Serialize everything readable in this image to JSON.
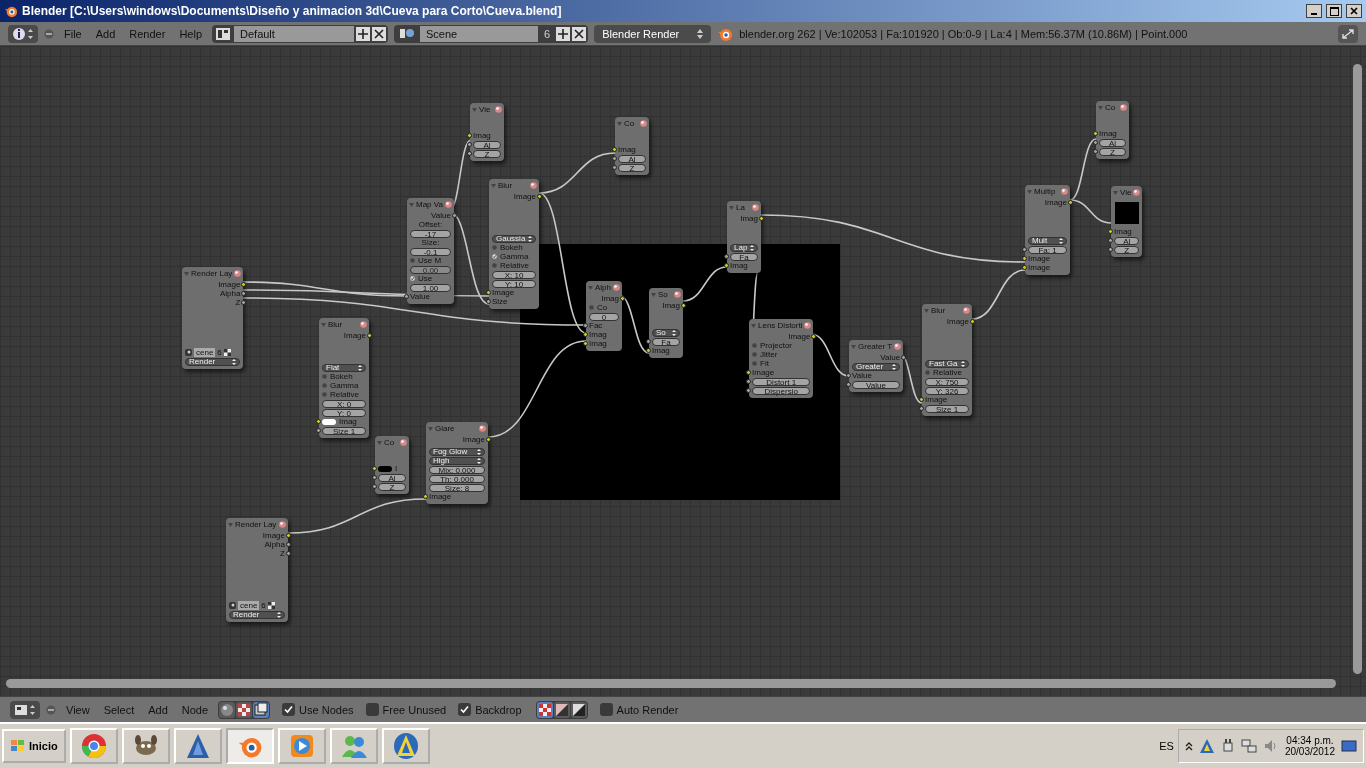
{
  "window": {
    "title": "Blender [C:\\Users\\windows\\Documents\\Diseño y animacion 3d\\Cueva para Corto\\Cueva.blend]"
  },
  "info_header": {
    "menus": [
      "File",
      "Add",
      "Render",
      "Help"
    ],
    "layout": "Default",
    "scene": "Scene",
    "scene_users": "6",
    "engine": "Blender Render",
    "stats": "blender.org 262 | Ve:102053 | Fa:101920 | Ob:0-9 | La:4 | Mem:56.37M (10.86M) | Point.000"
  },
  "node_editor": {
    "nodes": [
      {
        "title": "Vie",
        "rows": [
          {
            "kind": "in",
            "label": "Imag",
            "image_socket": true
          },
          {
            "kind": "field",
            "label": "Al",
            "image_socket": false
          },
          {
            "kind": "field",
            "label": "Z",
            "image_socket": false
          }
        ]
      },
      {
        "title": "Co",
        "rows": [
          {
            "kind": "in",
            "label": "Imag",
            "image_socket": true
          },
          {
            "kind": "field",
            "label": "Al",
            "image_socket": false
          },
          {
            "kind": "field",
            "label": "Z",
            "image_socket": false
          }
        ]
      },
      {
        "title": "Blur",
        "rows": [
          {
            "kind": "out",
            "label": "Image",
            "image_socket": true
          },
          {
            "kind": "menu",
            "label": "Gaussia"
          },
          {
            "kind": "option",
            "label": "Bokeh",
            "checked": false
          },
          {
            "kind": "option",
            "label": "Gamma",
            "checked": true
          },
          {
            "kind": "option",
            "label": "Relative",
            "checked": false
          },
          {
            "kind": "field",
            "label": "X: 10"
          },
          {
            "kind": "field",
            "label": "Y: 10"
          },
          {
            "kind": "in",
            "label": "Image",
            "image_socket": true
          },
          {
            "kind": "in",
            "label": "Size",
            "image_socket": false
          }
        ]
      },
      {
        "title": "Map Va",
        "rows": [
          {
            "kind": "out",
            "label": "Value",
            "image_socket": false
          },
          {
            "kind": "text",
            "label": "Offset:"
          },
          {
            "kind": "field",
            "label": "-17"
          },
          {
            "kind": "text",
            "label": "Size:"
          },
          {
            "kind": "field",
            "label": "-0.1"
          },
          {
            "kind": "option",
            "label": "Use M",
            "checked": false
          },
          {
            "kind": "field",
            "label": "0.00",
            "disabled": true
          },
          {
            "kind": "option",
            "label": "Use",
            "checked": true
          },
          {
            "kind": "field",
            "label": "1.00"
          },
          {
            "kind": "in",
            "label": "Value",
            "image_socket": false
          }
        ]
      },
      {
        "title": "Render Lay",
        "rows": [
          {
            "kind": "out",
            "label": "Image",
            "image_socket": true
          },
          {
            "kind": "out",
            "label": "Alpha",
            "image_socket": false
          },
          {
            "kind": "out",
            "label": "Z",
            "image_socket": false
          },
          {
            "kind": "scene",
            "label": "cene",
            "users": "6"
          },
          {
            "kind": "menu",
            "label": "Render"
          }
        ]
      },
      {
        "title": "Blur",
        "rows": [
          {
            "kind": "out",
            "label": "Image",
            "image_socket": true
          },
          {
            "kind": "menu",
            "label": "Flat"
          },
          {
            "kind": "option",
            "label": "Bokeh",
            "checked": false
          },
          {
            "kind": "option",
            "label": "Gamma",
            "checked": false
          },
          {
            "kind": "option",
            "label": "Relative",
            "checked": false
          },
          {
            "kind": "field",
            "label": "X: 0"
          },
          {
            "kind": "field",
            "label": "Y: 0"
          },
          {
            "kind": "swatch",
            "label": "Imag",
            "color": "#ffffff",
            "image_socket": true
          },
          {
            "kind": "field",
            "label": "Size 1",
            "image_socket": false
          }
        ]
      },
      {
        "title": "Alph",
        "rows": [
          {
            "kind": "out",
            "label": "Imag",
            "image_socket": true
          },
          {
            "kind": "option",
            "label": "Co",
            "checked": false
          },
          {
            "kind": "field",
            "label": "0"
          },
          {
            "kind": "in",
            "label": "Fac",
            "image_socket": false
          },
          {
            "kind": "in",
            "label": "Imag",
            "image_socket": true
          },
          {
            "kind": "in",
            "label": "Imag",
            "image_socket": true
          }
        ]
      },
      {
        "title": "So",
        "rows": [
          {
            "kind": "out",
            "label": "Imag",
            "image_socket": true
          },
          {
            "kind": "menu",
            "label": "So"
          },
          {
            "kind": "field",
            "label": "Fa",
            "image_socket": false
          },
          {
            "kind": "in",
            "label": "Imag",
            "image_socket": true
          }
        ]
      },
      {
        "title": "La",
        "rows": [
          {
            "kind": "out",
            "label": "Imag",
            "image_socket": true
          },
          {
            "kind": "menu",
            "label": "Lap"
          },
          {
            "kind": "field",
            "label": "Fa",
            "image_socket": false
          },
          {
            "kind": "in",
            "label": "Imag",
            "image_socket": true
          }
        ]
      },
      {
        "title": "Lens Distorti",
        "rows": [
          {
            "kind": "out",
            "label": "Image",
            "image_socket": true
          },
          {
            "kind": "option",
            "label": "Projector",
            "checked": false
          },
          {
            "kind": "option",
            "label": "Jitter",
            "checked": false
          },
          {
            "kind": "option",
            "label": "Fit",
            "checked": false
          },
          {
            "kind": "in",
            "label": "Image",
            "image_socket": true
          },
          {
            "kind": "field",
            "label": "Distort 1",
            "image_socket": false
          },
          {
            "kind": "field",
            "label": "Dispersio",
            "image_socket": false
          }
        ]
      },
      {
        "title": "Greater T",
        "rows": [
          {
            "kind": "out",
            "label": "Value",
            "image_socket": false
          },
          {
            "kind": "menu",
            "label": "Greater"
          },
          {
            "kind": "in",
            "label": "Value",
            "image_socket": false
          },
          {
            "kind": "field",
            "label": "Value",
            "image_socket": false
          }
        ]
      },
      {
        "title": "Blur",
        "rows": [
          {
            "kind": "out",
            "label": "Image",
            "image_socket": true
          },
          {
            "kind": "menu",
            "label": "Fast Ga"
          },
          {
            "kind": "option",
            "label": "Relative",
            "checked": false
          },
          {
            "kind": "field",
            "label": "X: 750"
          },
          {
            "kind": "field",
            "label": "Y: 326"
          },
          {
            "kind": "in",
            "label": "Image",
            "image_socket": true
          },
          {
            "kind": "field",
            "label": "Size 1",
            "image_socket": false
          }
        ]
      },
      {
        "title": "Multip",
        "rows": [
          {
            "kind": "out",
            "label": "Image",
            "image_socket": true
          },
          {
            "kind": "menu",
            "label": "Mult"
          },
          {
            "kind": "field",
            "label": "Fa: 1",
            "image_socket": false
          },
          {
            "kind": "in",
            "label": "Image",
            "image_socket": true
          },
          {
            "kind": "in",
            "label": "Image",
            "image_socket": true
          }
        ]
      },
      {
        "title": "Co",
        "rows": [
          {
            "kind": "in",
            "label": "Imag",
            "image_socket": true
          },
          {
            "kind": "field",
            "label": "Al",
            "image_socket": false
          },
          {
            "kind": "field",
            "label": "Z",
            "image_socket": false
          }
        ]
      },
      {
        "title": "Vie",
        "rows": [
          {
            "kind": "preview"
          },
          {
            "kind": "in",
            "label": "Imag",
            "image_socket": true
          },
          {
            "kind": "field",
            "label": "Al",
            "image_socket": false
          },
          {
            "kind": "field",
            "label": "Z",
            "image_socket": false
          }
        ]
      },
      {
        "title": "Co",
        "rows": [
          {
            "kind": "swatch",
            "label": "I",
            "color": "#000000",
            "image_socket": true
          },
          {
            "kind": "field",
            "label": "Al",
            "image_socket": false
          },
          {
            "kind": "field",
            "label": "Z",
            "image_socket": false
          }
        ]
      },
      {
        "title": "Glare",
        "rows": [
          {
            "kind": "out",
            "label": "Image",
            "image_socket": true
          },
          {
            "kind": "menu",
            "label": "Fog Glow"
          },
          {
            "kind": "menu",
            "label": "High"
          },
          {
            "kind": "field",
            "label": "Mix: 0.000"
          },
          {
            "kind": "field",
            "label": "Th: 0.000"
          },
          {
            "kind": "field",
            "label": "Size: 8"
          },
          {
            "kind": "in",
            "label": "Image",
            "image_socket": true
          }
        ]
      },
      {
        "title": "Render Lay",
        "rows": [
          {
            "kind": "out",
            "label": "Image",
            "image_socket": true
          },
          {
            "kind": "out",
            "label": "Alpha",
            "image_socket": false
          },
          {
            "kind": "out",
            "label": "Z",
            "image_socket": false
          },
          {
            "kind": "scene",
            "label": "cene",
            "users": "6"
          },
          {
            "kind": "menu",
            "label": "Render"
          }
        ]
      }
    ]
  },
  "node_header": {
    "menus": [
      "View",
      "Select",
      "Add",
      "Node"
    ],
    "tree_types": [
      {
        "selected": false
      },
      {
        "selected": false
      },
      {
        "selected": true
      }
    ],
    "checkboxes": [
      {
        "label": "Use Nodes",
        "checked": true
      },
      {
        "label": "Free Unused",
        "checked": false
      },
      {
        "label": "Backdrop",
        "checked": true
      },
      {
        "label": "Auto Render",
        "checked": false
      }
    ],
    "backdrop_channels": [
      {
        "selected": true
      },
      {
        "selected": false
      },
      {
        "selected": false
      }
    ]
  },
  "taskbar": {
    "start": "Inicio",
    "apps": [
      {
        "selected": false
      },
      {
        "selected": false
      },
      {
        "selected": false
      },
      {
        "selected": true
      },
      {
        "selected": false
      },
      {
        "selected": false
      },
      {
        "selected": false
      }
    ],
    "language": "ES",
    "time": "04:34 p.m.",
    "date": "20/03/2012"
  }
}
